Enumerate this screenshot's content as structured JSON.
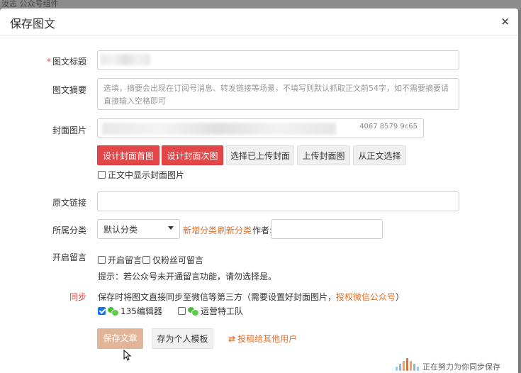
{
  "background": {
    "strip_text": "汝志   公众号组件"
  },
  "dialog": {
    "title": "保存图文",
    "close_label": "×"
  },
  "form": {
    "title_label": "图文标题",
    "required_mark": "*",
    "title_value": "",
    "summary_label": "图文摘要",
    "summary_placeholder": "选填，摘要会出现在订阅号消息、转发链接等场景，不填写则默认抓取正文前54字，如不需要摘要请直接输入空格即可",
    "cover_label": "封面图片",
    "cover_url_suffix": "4067 8579 9c65",
    "cover_buttons": [
      "设计封面首图",
      "设计封面次图",
      "选择已上传封面",
      "上传封面图",
      "从正文选择"
    ],
    "show_cover_label": "正文中显示封面图片",
    "origin_link_label": "原文链接",
    "origin_link_value": "",
    "category_label": "所属分类",
    "category_selected": "默认分类",
    "add_category": "新增分类",
    "refresh_category": "刷新分类",
    "author_label": "作者:",
    "author_value": "",
    "comment_label": "开启留言",
    "enable_comment": "开启留言",
    "fans_only": "仅粉丝可留言",
    "comment_tip": "提示：若公众号未开通留言功能，请勿选择是。",
    "sync_label": "同步",
    "sync_desc": "保存时将图文直接同步至微信等第三方（需要设置好封面图片，",
    "sync_auth_link": "授权微信公众号",
    "sync_desc_end": "）",
    "sync_target_1": "135编辑器",
    "sync_target_2": "运营特工队"
  },
  "footer": {
    "save_button": "保存文章",
    "template_button": "存为个人模板",
    "submit_link": "投稿给其他用户",
    "status_text": "正在努力为你同步保存"
  },
  "colors": {
    "accent_red": "#e24646",
    "link_orange": "#e5702a",
    "save_button_bg": "#e3b598",
    "checkbox_blue": "#1a73e8"
  }
}
